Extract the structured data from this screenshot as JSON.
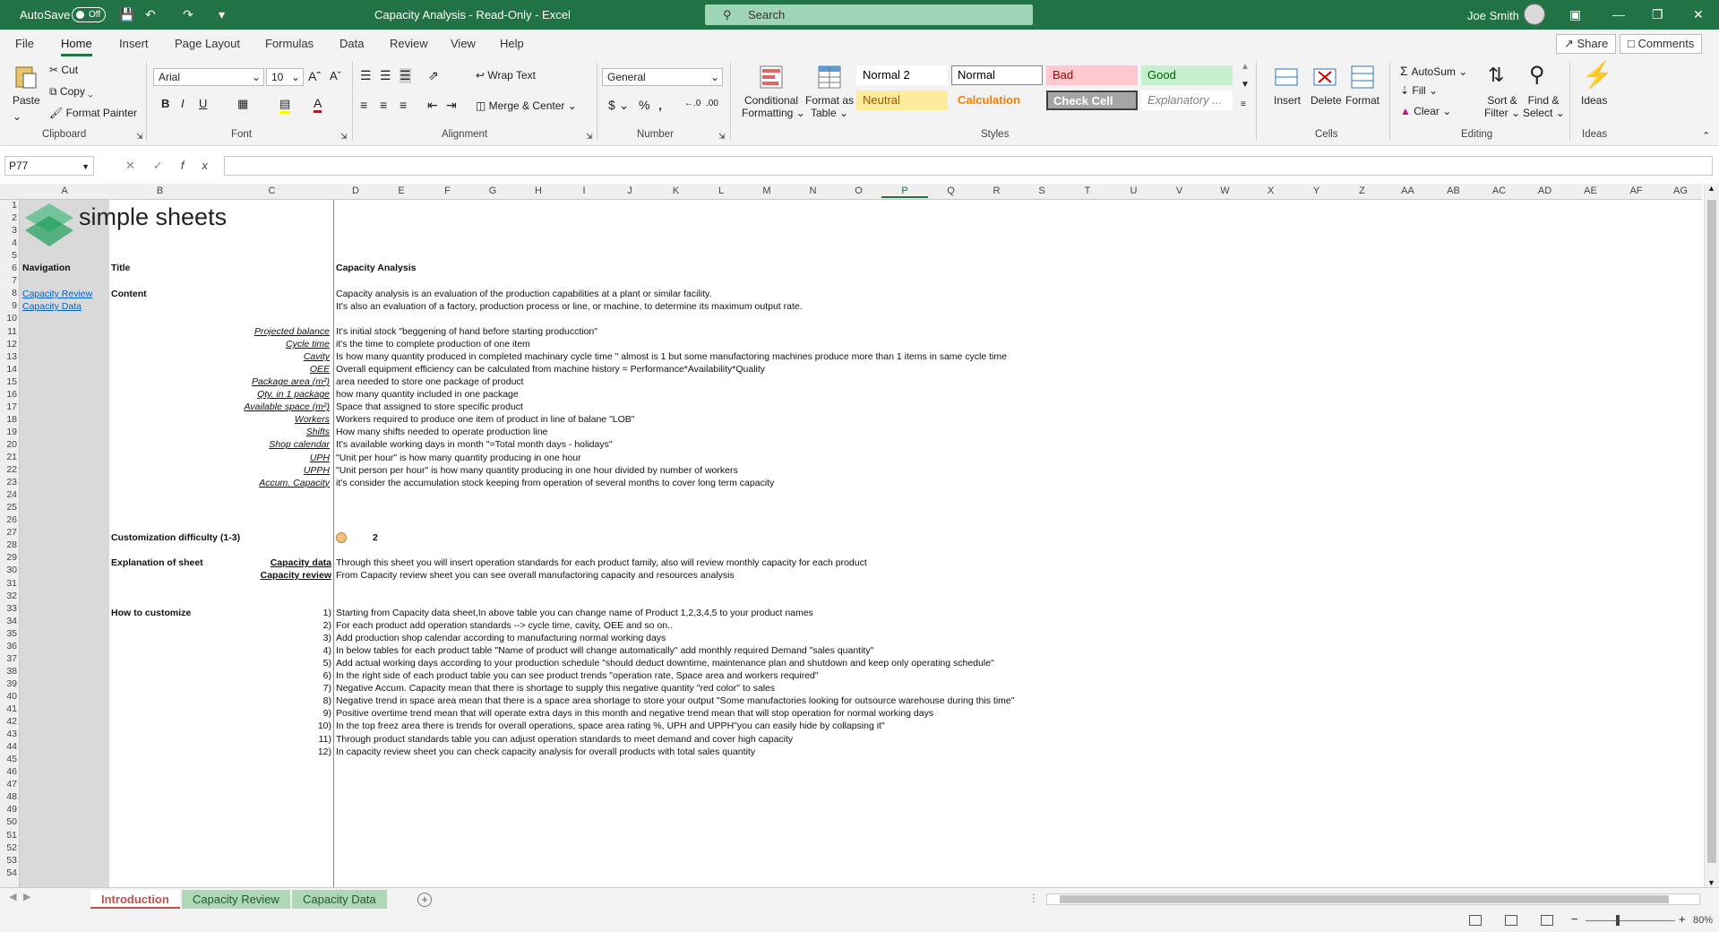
{
  "titlebar": {
    "autosave_label": "AutoSave",
    "autosave_state": "Off",
    "title": "Capacity Analysis  -  Read-Only  -  Excel",
    "search_placeholder": "Search",
    "user_name": "Joe Smith"
  },
  "menu": {
    "items": [
      "File",
      "Home",
      "Insert",
      "Page Layout",
      "Formulas",
      "Data",
      "Review",
      "View",
      "Help"
    ],
    "active": "Home",
    "share": "Share",
    "comments": "Comments"
  },
  "ribbon": {
    "clipboard": {
      "paste": "Paste",
      "cut": "Cut",
      "copy": "Copy",
      "format_painter": "Format Painter",
      "label": "Clipboard"
    },
    "font": {
      "name": "Arial",
      "size": "10",
      "label": "Font"
    },
    "alignment": {
      "wrap_text": "Wrap Text",
      "merge_center": "Merge & Center",
      "label": "Alignment"
    },
    "number": {
      "format": "General",
      "label": "Number"
    },
    "styles": {
      "conditional": "Conditional",
      "conditional2": "Formatting",
      "format_as": "Format as",
      "format_as2": "Table",
      "cells": [
        {
          "name": "Normal 2",
          "bg": "#ffffff",
          "fg": "#000000"
        },
        {
          "name": "Normal",
          "bg": "#ffffff",
          "fg": "#000000"
        },
        {
          "name": "Bad",
          "bg": "#ffc7ce",
          "fg": "#9c0006"
        },
        {
          "name": "Good",
          "bg": "#c6efce",
          "fg": "#006100"
        },
        {
          "name": "Neutral",
          "bg": "#ffeb9c",
          "fg": "#9c5700"
        },
        {
          "name": "Calculation",
          "bg": "#f2f2f2",
          "fg": "#fa7d00"
        },
        {
          "name": "Check Cell",
          "bg": "#a5a5a5",
          "fg": "#ffffff"
        },
        {
          "name": "Explanatory ...",
          "bg": "#ffffff",
          "fg": "#7f7f7f"
        }
      ],
      "label": "Styles"
    },
    "cells_group": {
      "insert": "Insert",
      "delete": "Delete",
      "format": "Format",
      "label": "Cells"
    },
    "editing": {
      "autosum": "AutoSum",
      "fill": "Fill",
      "clear": "Clear",
      "sort": "Sort &",
      "sort2": "Filter",
      "find": "Find &",
      "find2": "Select",
      "label": "Editing"
    },
    "ideas": {
      "ideas": "Ideas",
      "label": "Ideas"
    }
  },
  "formula_bar": {
    "name_box": "P77",
    "fx": "fx",
    "value": ""
  },
  "columns": [
    "A",
    "B",
    "C",
    "D",
    "E",
    "F",
    "G",
    "H",
    "I",
    "J",
    "K",
    "L",
    "M",
    "N",
    "O",
    "P",
    "Q",
    "R",
    "S",
    "T",
    "U",
    "V",
    "W",
    "X",
    "Y",
    "Z",
    "AA",
    "AB",
    "AC",
    "AD",
    "AE",
    "AF",
    "AG"
  ],
  "rows": [
    "1",
    "2",
    "3",
    "4",
    "5",
    "6",
    "7",
    "8",
    "9",
    "10",
    "11",
    "12",
    "13",
    "14",
    "15",
    "16",
    "17",
    "18",
    "19",
    "20",
    "21",
    "22",
    "23",
    "24",
    "25",
    "26",
    "27",
    "28",
    "29",
    "30",
    "31",
    "32",
    "33",
    "34",
    "35",
    "36",
    "37",
    "38",
    "39",
    "40",
    "41",
    "42",
    "43",
    "44",
    "45",
    "46",
    "47",
    "48",
    "49",
    "50",
    "51",
    "52",
    "53",
    "54"
  ],
  "sheet": {
    "logo_text": "simple sheets",
    "navigation_label": "Navigation",
    "nav_links": [
      "Capacity Review",
      "Capacity Data"
    ],
    "title_label": "Title",
    "title_value": "Capacity Analysis",
    "content_label": "Content",
    "content_lines": [
      "Capacity analysis is an evaluation of the production capabilities at a plant or similar facility.",
      "It's also an evaluation of a factory, production process or line, or machine, to determine its maximum output rate."
    ],
    "definitions": [
      {
        "term": "Projected balance",
        "text": "It's initial stock \"beggening of hand before starting producction\""
      },
      {
        "term": "Cycle time",
        "text": "it's the time to complete production of one item"
      },
      {
        "term": "Cavity",
        "text": "Is how many quantity produced in completed machinary cycle time \" almost is 1 but some manufactoring machines produce more than 1 items in same cycle time"
      },
      {
        "term": "OEE",
        "text": "Overall equipment efficiency can be calculated from machine history = Performance*Availability*Quality"
      },
      {
        "term": "Package area (m²)",
        "text": "area needed to store one package of product"
      },
      {
        "term": "Qty. in 1 package",
        "text": "how many quantity included in one package"
      },
      {
        "term": "Available space (m²)",
        "text": "Space that assigned to store specific product"
      },
      {
        "term": "Workers",
        "text": "Workers required to produce one item of product in line of balane \"LOB\""
      },
      {
        "term": "Shifts",
        "text": "How many shifts needed to operate production line"
      },
      {
        "term": "Shop calendar",
        "text": "It's available working days in month \"=Total month days - holidays\""
      },
      {
        "term": "UPH",
        "text": "\"Unit per hour\" is how many quantity producing in one hour"
      },
      {
        "term": "UPPH",
        "text": "\"Unit person per hour\" is how many quantity producing in one hour divided by number of workers"
      },
      {
        "term": "Accum. Capacity",
        "text": "it's consider the accumulation stock keeping from operation of several months to cover long term capacity"
      }
    ],
    "difficulty_label": "Customization difficulty (1-3)",
    "difficulty_value": "2",
    "explanation_label": "Explanation of sheet",
    "explanations": [
      {
        "term": "Capacity data",
        "text": "Through this sheet you will insert operation standards for each product family, also will review monthly capacity for each product"
      },
      {
        "term": "Capacity review",
        "text": "From Capacity review sheet you can see overall manufactoring capacity and resources analysis"
      }
    ],
    "howto_label": "How to customize",
    "howto": [
      {
        "n": "1)",
        "text": "Starting from Capacity data sheet,In above table you can change name of Product 1,2,3,4,5 to your product names"
      },
      {
        "n": "2)",
        "text": "For each product add operation standards --> cycle time, cavity, OEE and so on.."
      },
      {
        "n": "3)",
        "text": "Add production shop calendar according to manufacturing normal working days"
      },
      {
        "n": "4)",
        "text": "In below tables for each product table \"Name of product will change automatically\" add monthly required Demand \"sales quantity\""
      },
      {
        "n": "5)",
        "text": "Add actual working days according to your production schedule \"should deduct downtime, maintenance plan and shutdown and keep only operating schedule\""
      },
      {
        "n": "6)",
        "text": "In the right side of each product table you can see product trends \"operation rate, Space area and workers required\""
      },
      {
        "n": "7)",
        "text": "Negative Accum. Capacity mean that there is shortage to supply this negative quantity \"red color\" to sales"
      },
      {
        "n": "8)",
        "text": "Negative trend in space area mean that there is a space area shortage to store your output \"Some manufactories looking for outsource warehouse during this time\""
      },
      {
        "n": "9)",
        "text": "Positive overtime trend mean that will operate extra days in this month and negative trend mean that will stop operation for normal working days"
      },
      {
        "n": "10)",
        "text": "In the top freez area there is  trends for overall operations, space area rating %, UPH and UPPH\"you can easily hide by collapsing it\""
      },
      {
        "n": "11)",
        "text": "Through product standards table you can adjust operation standards to meet demand and cover high capacity"
      },
      {
        "n": "12)",
        "text": "In capacity review sheet you can check capacity analysis for overall products with total sales quantity"
      }
    ]
  },
  "tabs": [
    "Introduction",
    "Capacity Review",
    "Capacity Data"
  ],
  "status": {
    "zoom": "80%"
  }
}
